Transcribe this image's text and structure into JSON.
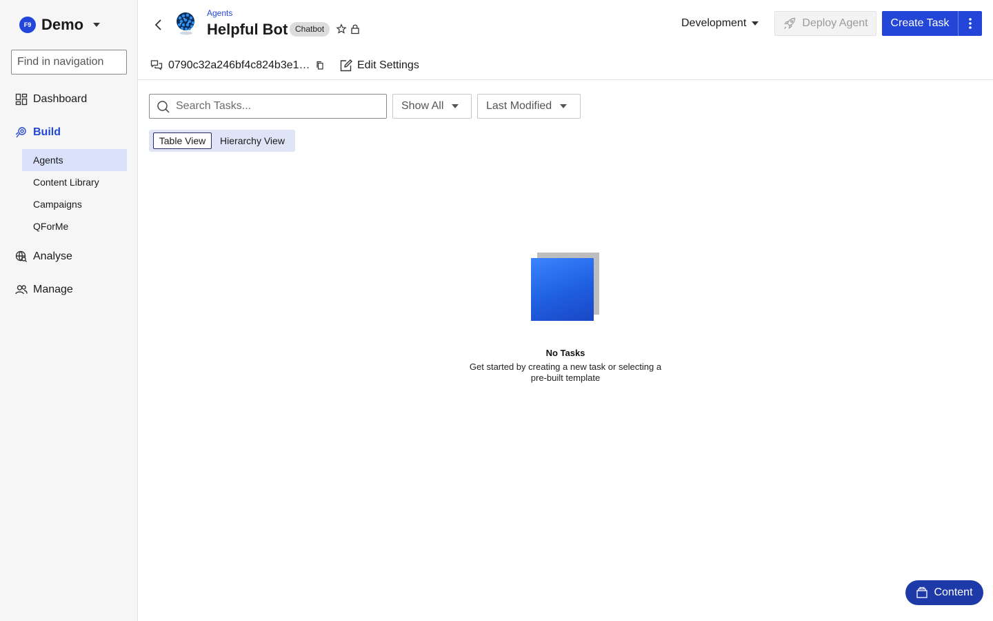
{
  "sidebar": {
    "org": {
      "badge": "F9",
      "name": "Demo"
    },
    "search_placeholder": "Find in navigation",
    "items": [
      {
        "label": "Dashboard",
        "icon": "dashboard-icon"
      },
      {
        "label": "Build",
        "icon": "build-icon"
      },
      {
        "label": "Analyse",
        "icon": "analyse-icon"
      },
      {
        "label": "Manage",
        "icon": "manage-icon"
      }
    ],
    "build_sub": [
      {
        "label": "Agents"
      },
      {
        "label": "Content Library"
      },
      {
        "label": "Campaigns"
      },
      {
        "label": "QForMe"
      }
    ],
    "active_item": "Build",
    "selected_sub": "Agents"
  },
  "header": {
    "breadcrumb": "Agents",
    "title": "Helpful Bot",
    "type_chip": "Chatbot",
    "environment": "Development",
    "deploy_label": "Deploy Agent",
    "create_label": "Create Task",
    "agent_id": "0790c32a246bf4c824b3e1…",
    "edit_settings": "Edit Settings"
  },
  "filters": {
    "search_placeholder": "Search Tasks...",
    "show": "Show All",
    "sort": "Last Modified"
  },
  "views": {
    "table": "Table View",
    "hierarchy": "Hierarchy View",
    "active": "Table View"
  },
  "empty": {
    "title": "No Tasks",
    "description": "Get started by creating a new task or selecting a pre-built template"
  },
  "content_button": "Content",
  "colors": {
    "accent": "#2346d8",
    "nav_selected_bg": "#d9e1fb",
    "content_button": "#1e3aa8"
  }
}
